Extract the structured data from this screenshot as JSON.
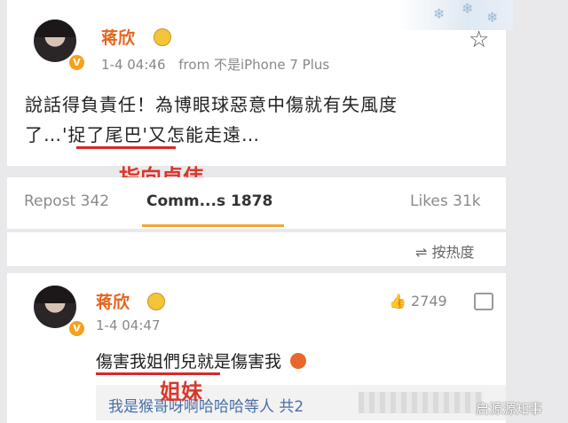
{
  "post": {
    "username": "蒋欣",
    "timestamp": "1-4 04:46",
    "source": "from 不是iPhone 7 Plus",
    "text_line1": "說話得負責任！為博眼球惡意中傷就有失風度",
    "text_line2": "了…'捉了尾巴'又怎能走遠…",
    "verified_mark": "V"
  },
  "annotations": {
    "arrow_label": "指向卓伟",
    "sister_label": "姐妹"
  },
  "actions": {
    "repost": "Repost 342",
    "comments": "Comm...s 1878",
    "likes": "Likes 31k"
  },
  "sort": {
    "label": "按热度",
    "icon": "sort-icon"
  },
  "comment": {
    "username": "蒋欣",
    "timestamp": "1-4 04:47",
    "likes": "2749",
    "text": "傷害我姐們兒就是傷害我",
    "reply_preview": "我是猴哥呀啊哈哈哈等人  共2",
    "verified_mark": "V"
  },
  "watermark": "启源源知事",
  "colors": {
    "username": "#e6661d",
    "badge": "#f5a11c",
    "annotation": "#d9382a",
    "tab_underline": "#f0a536"
  }
}
